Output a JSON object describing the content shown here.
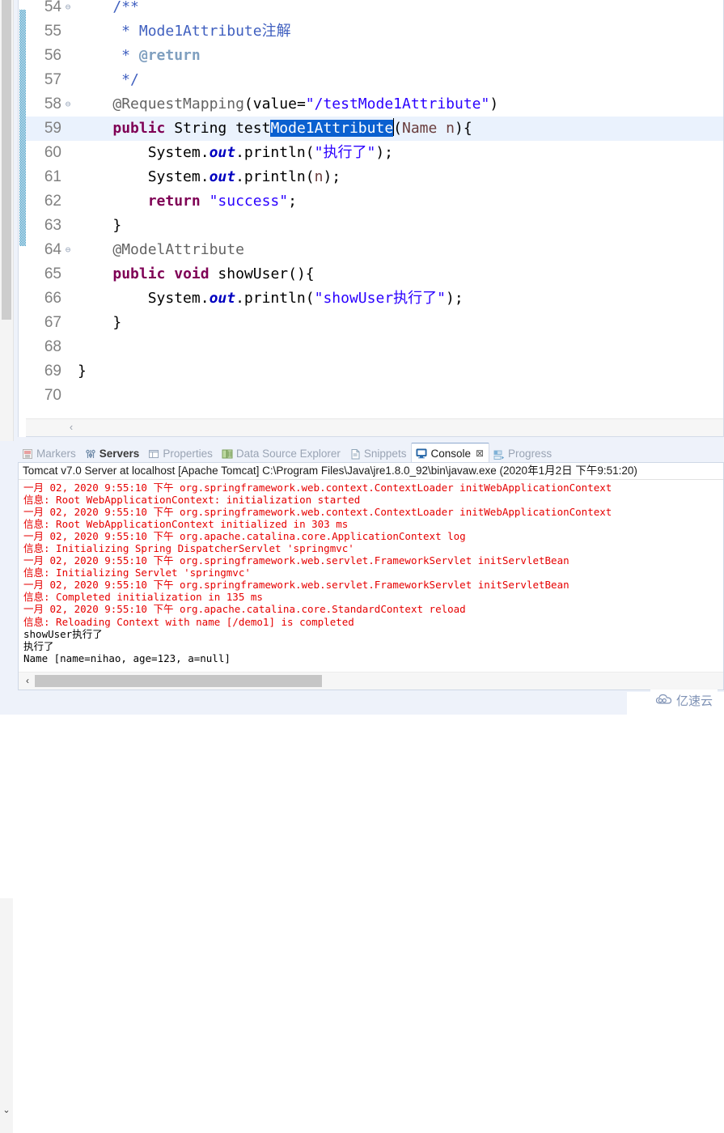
{
  "editor": {
    "first_partial_line": "53",
    "lines": [
      {
        "num": "54",
        "fold": "⊖",
        "changed": true,
        "current": false,
        "tokens": [
          {
            "t": "    ",
            "c": "plain"
          },
          {
            "t": "/**",
            "c": "jdoc"
          }
        ]
      },
      {
        "num": "55",
        "fold": "",
        "changed": true,
        "current": false,
        "tokens": [
          {
            "t": "     * ",
            "c": "jdoc"
          },
          {
            "t": "Mode1Attribute注解",
            "c": "jdoc"
          }
        ]
      },
      {
        "num": "56",
        "fold": "",
        "changed": true,
        "current": false,
        "tokens": [
          {
            "t": "     * ",
            "c": "jdoc"
          },
          {
            "t": "@return",
            "c": "jdoctag"
          }
        ]
      },
      {
        "num": "57",
        "fold": "",
        "changed": true,
        "current": false,
        "tokens": [
          {
            "t": "     */",
            "c": "jdoc"
          }
        ]
      },
      {
        "num": "58",
        "fold": "⊖",
        "changed": true,
        "current": false,
        "tokens": [
          {
            "t": "    ",
            "c": "plain"
          },
          {
            "t": "@RequestMapping",
            "c": "ann"
          },
          {
            "t": "(value=",
            "c": "plain"
          },
          {
            "t": "\"/testMode1Attribute\"",
            "c": "str"
          },
          {
            "t": ")",
            "c": "plain"
          }
        ]
      },
      {
        "num": "59",
        "fold": "",
        "changed": true,
        "current": true,
        "tokens": [
          {
            "t": "    ",
            "c": "plain"
          },
          {
            "t": "public",
            "c": "kw"
          },
          {
            "t": " String test",
            "c": "plain"
          },
          {
            "t": "Mode1Attribute",
            "c": "sel"
          },
          {
            "t": "(",
            "c": "plain"
          },
          {
            "t": "Name n",
            "c": "param"
          },
          {
            "t": "){",
            "c": "plain"
          }
        ]
      },
      {
        "num": "60",
        "fold": "",
        "changed": true,
        "current": false,
        "tokens": [
          {
            "t": "        System.",
            "c": "plain"
          },
          {
            "t": "out",
            "c": "fld"
          },
          {
            "t": ".println(",
            "c": "plain"
          },
          {
            "t": "\"执行了\"",
            "c": "str"
          },
          {
            "t": ");",
            "c": "plain"
          }
        ]
      },
      {
        "num": "61",
        "fold": "",
        "changed": true,
        "current": false,
        "tokens": [
          {
            "t": "        System.",
            "c": "plain"
          },
          {
            "t": "out",
            "c": "fld"
          },
          {
            "t": ".println(",
            "c": "plain"
          },
          {
            "t": "n",
            "c": "param"
          },
          {
            "t": ");",
            "c": "plain"
          }
        ]
      },
      {
        "num": "62",
        "fold": "",
        "changed": true,
        "current": false,
        "tokens": [
          {
            "t": "        ",
            "c": "plain"
          },
          {
            "t": "return",
            "c": "kw"
          },
          {
            "t": " ",
            "c": "plain"
          },
          {
            "t": "\"success\"",
            "c": "str"
          },
          {
            "t": ";",
            "c": "plain"
          }
        ]
      },
      {
        "num": "63",
        "fold": "",
        "changed": true,
        "current": false,
        "tokens": [
          {
            "t": "    }",
            "c": "plain"
          }
        ]
      },
      {
        "num": "64",
        "fold": "⊖",
        "changed": false,
        "current": false,
        "tokens": [
          {
            "t": "    ",
            "c": "plain"
          },
          {
            "t": "@ModelAttribute",
            "c": "ann"
          }
        ]
      },
      {
        "num": "65",
        "fold": "",
        "changed": false,
        "current": false,
        "tokens": [
          {
            "t": "    ",
            "c": "plain"
          },
          {
            "t": "public",
            "c": "kw"
          },
          {
            "t": " ",
            "c": "plain"
          },
          {
            "t": "void",
            "c": "kw"
          },
          {
            "t": " showUser(){",
            "c": "plain"
          }
        ]
      },
      {
        "num": "66",
        "fold": "",
        "changed": false,
        "current": false,
        "tokens": [
          {
            "t": "        System.",
            "c": "plain"
          },
          {
            "t": "out",
            "c": "fld"
          },
          {
            "t": ".println(",
            "c": "plain"
          },
          {
            "t": "\"showUser执行了\"",
            "c": "str"
          },
          {
            "t": ");",
            "c": "plain"
          }
        ]
      },
      {
        "num": "67",
        "fold": "",
        "changed": false,
        "current": false,
        "tokens": [
          {
            "t": "    }",
            "c": "plain"
          }
        ]
      },
      {
        "num": "68",
        "fold": "",
        "changed": false,
        "current": false,
        "tokens": []
      },
      {
        "num": "69",
        "fold": "",
        "changed": false,
        "current": false,
        "tokens": [
          {
            "t": "}",
            "c": "plain"
          }
        ]
      },
      {
        "num": "70",
        "fold": "",
        "changed": false,
        "current": false,
        "tokens": []
      }
    ],
    "hscroll_left_label": "‹"
  },
  "view_tabs": [
    {
      "label": "Markers",
      "icon": "markers-icon",
      "active": false,
      "bold": false,
      "closable": false
    },
    {
      "label": "Servers",
      "icon": "servers-icon",
      "active": false,
      "bold": true,
      "closable": false
    },
    {
      "label": "Properties",
      "icon": "properties-icon",
      "active": false,
      "bold": false,
      "closable": false
    },
    {
      "label": "Data Source Explorer",
      "icon": "data-source-explorer-icon",
      "active": false,
      "bold": false,
      "closable": false
    },
    {
      "label": "Snippets",
      "icon": "snippets-icon",
      "active": false,
      "bold": false,
      "closable": false
    },
    {
      "label": "Console",
      "icon": "console-icon",
      "active": true,
      "bold": false,
      "closable": true,
      "close_glyph": "⊠"
    },
    {
      "label": "Progress",
      "icon": "progress-icon",
      "active": false,
      "bold": false,
      "closable": false
    }
  ],
  "console": {
    "title": "Tomcat v7.0 Server at localhost [Apache Tomcat] C:\\Program Files\\Java\\jre1.8.0_92\\bin\\javaw.exe (2020年1月2日 下午9:51:20)",
    "lines": [
      {
        "text": "一月 02, 2020 9:55:10 下午 org.springframework.web.context.ContextLoader initWebApplicationContext",
        "kind": "err"
      },
      {
        "text": "信息: Root WebApplicationContext: initialization started",
        "kind": "err"
      },
      {
        "text": "一月 02, 2020 9:55:10 下午 org.springframework.web.context.ContextLoader initWebApplicationContext",
        "kind": "err"
      },
      {
        "text": "信息: Root WebApplicationContext initialized in 303 ms",
        "kind": "err"
      },
      {
        "text": "一月 02, 2020 9:55:10 下午 org.apache.catalina.core.ApplicationContext log",
        "kind": "err"
      },
      {
        "text": "信息: Initializing Spring DispatcherServlet 'springmvc'",
        "kind": "err"
      },
      {
        "text": "一月 02, 2020 9:55:10 下午 org.springframework.web.servlet.FrameworkServlet initServletBean",
        "kind": "err"
      },
      {
        "text": "信息: Initializing Servlet 'springmvc'",
        "kind": "err"
      },
      {
        "text": "一月 02, 2020 9:55:10 下午 org.springframework.web.servlet.FrameworkServlet initServletBean",
        "kind": "err"
      },
      {
        "text": "信息: Completed initialization in 135 ms",
        "kind": "err"
      },
      {
        "text": "一月 02, 2020 9:55:10 下午 org.apache.catalina.core.StandardContext reload",
        "kind": "err"
      },
      {
        "text": "信息: Reloading Context with name [/demo1] is completed",
        "kind": "err"
      },
      {
        "text": "showUser执行了",
        "kind": "out"
      },
      {
        "text": "执行了",
        "kind": "out"
      },
      {
        "text": "Name [name=nihao, age=123, a=null]",
        "kind": "out"
      }
    ],
    "vscroll_down_glyph": "⌄",
    "hscroll_left_glyph": "‹"
  },
  "watermark": {
    "text": "亿速云"
  },
  "colors": {
    "selection": "#0a60d0",
    "current_line": "#eaf2fd",
    "console_error": "#e60000",
    "keyword": "#7f0055",
    "string": "#2a00ff",
    "javadoc": "#3f5fbf",
    "annotation": "#646464",
    "change_bar": "#2c8fbe",
    "chrome": "#eef2fa"
  }
}
